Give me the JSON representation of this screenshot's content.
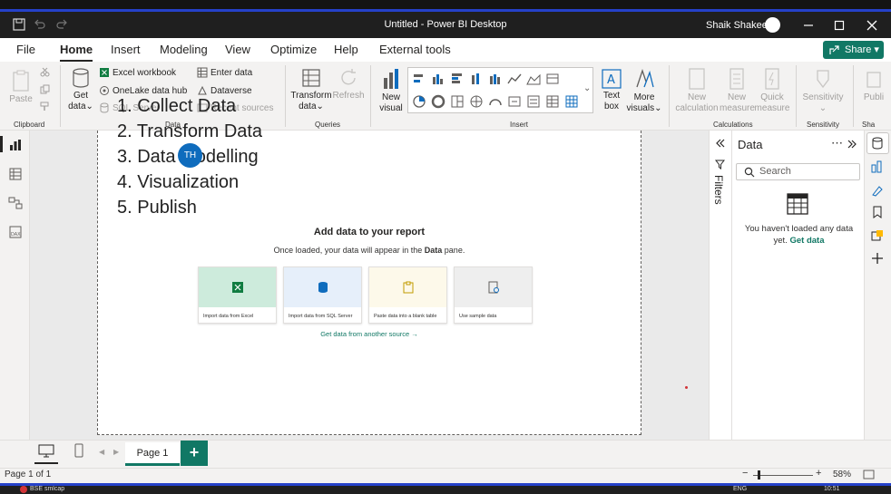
{
  "app": {
    "window_title": "Untitled - Power BI Desktop",
    "user_name": "Shaik Shakeel"
  },
  "ribbon": {
    "tabs": [
      "File",
      "Home",
      "Insert",
      "Modeling",
      "View",
      "Optimize",
      "Help",
      "External tools"
    ],
    "active_tab": "Home",
    "share_label": "Share",
    "clipboard": {
      "paste": "Paste",
      "group": "Clipboard"
    },
    "data": {
      "get_data_1": "Get",
      "get_data_2": "data",
      "excel": "Excel workbook",
      "onelake": "OneLake data hub",
      "sql": "SQL Server",
      "enter": "Enter data",
      "dataverse": "Dataverse",
      "recent": "Recent sources",
      "group": "Data"
    },
    "queries": {
      "transform_1": "Transform",
      "transform_2": "data",
      "refresh": "Refresh",
      "group": "Queries"
    },
    "insert": {
      "new_visual_1": "New",
      "new_visual_2": "visual",
      "text_box_1": "Text",
      "text_box_2": "box",
      "more_visuals_1": "More",
      "more_visuals_2": "visuals",
      "group": "Insert"
    },
    "calculations": {
      "new_measure_1": "New",
      "new_measure_2": "measure",
      "new_column_1": "New",
      "new_column_2": "calculation",
      "quick_1": "Quick",
      "quick_2": "measure",
      "group": "Calculations"
    },
    "sensitivity": {
      "label": "Sensitivity",
      "group": "Sensitivity"
    },
    "share": {
      "publish": "Publi",
      "group": "Sha"
    }
  },
  "overlay_list": [
    "1. Collect Data",
    "2. Transform Data",
    "3. Data Modelling",
    "4. Visualization",
    "5. Publish"
  ],
  "presenter_initials": "TH",
  "canvas": {
    "title": "Add data to your report",
    "subtitle_pre": "Once loaded, your data will appear in the ",
    "subtitle_bold": "Data",
    "subtitle_post": " pane.",
    "cards": [
      {
        "label": "Import data from Excel",
        "color": "#cdebdc"
      },
      {
        "label": "Import data from SQL Server",
        "color": "#e6effa"
      },
      {
        "label": "Paste data into a blank table",
        "color": "#fdf9ea"
      },
      {
        "label": "Use sample data",
        "color": "#eeeeee"
      }
    ],
    "get_more": "Get data from another source →"
  },
  "filters_label": "Filters",
  "data_pane": {
    "title": "Data",
    "search_placeholder": "Search",
    "empty_text": "You haven't loaded any data yet.",
    "empty_link": "Get data"
  },
  "pages": {
    "tab_label": "Page 1",
    "add_label": "+"
  },
  "status": {
    "page_info": "Page 1 of 1",
    "zoom": "58%"
  },
  "taskbar": {
    "item": "BSE smlcap",
    "lang": "ENG",
    "time": "10:51"
  },
  "colors": {
    "accent": "#117865",
    "brand_blue": "#2541c9",
    "presenter_blue": "#0f6cbd"
  }
}
